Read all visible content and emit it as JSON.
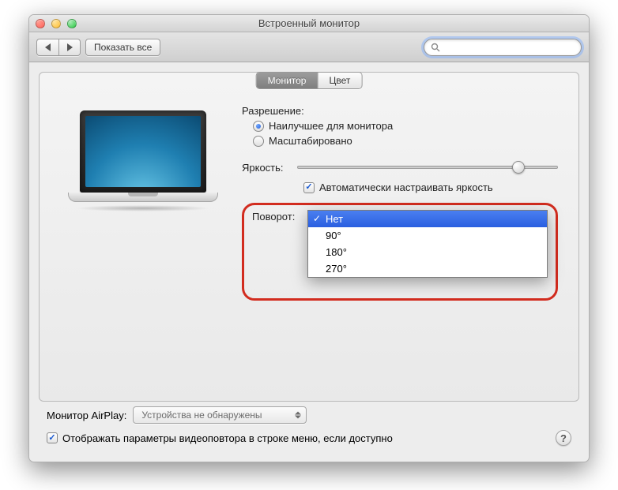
{
  "window_title": "Встроенный монитор",
  "toolbar": {
    "show_all_label": "Показать все",
    "search_placeholder": ""
  },
  "tabs": {
    "monitor": "Монитор",
    "color": "Цвет"
  },
  "settings": {
    "resolution_label": "Разрешение:",
    "resolution_best": "Наилучшее для монитора",
    "resolution_scaled": "Масштабировано",
    "brightness_label": "Яркость:",
    "brightness_value": 85,
    "auto_brightness": "Автоматически настраивать яркость",
    "rotation_label": "Поворот:",
    "rotation_options": {
      "none": "Нет",
      "r90": "90°",
      "r180": "180°",
      "r270": "270°"
    },
    "rotation_selected": "Нет"
  },
  "airplay": {
    "label": "Монитор AirPlay:",
    "value": "Устройства не обнаружены"
  },
  "mirror_checkbox": "Отображать параметры видеоповтора в строке меню, если доступно",
  "help_glyph": "?"
}
